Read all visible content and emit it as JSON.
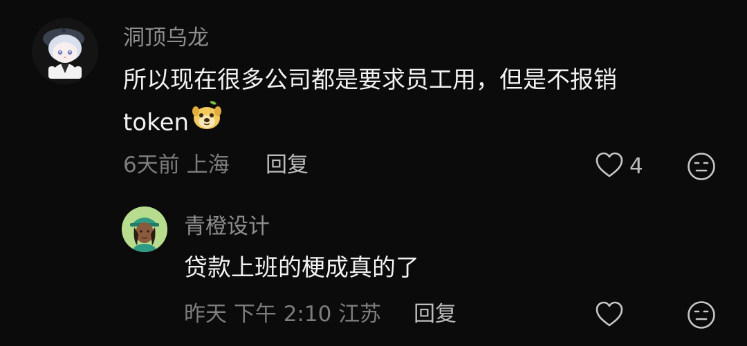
{
  "comments": [
    {
      "username": "洞顶乌龙",
      "text_line1": "所以现在很多公司都是要求员工用，但是不报销",
      "text_line2": "token",
      "inline_emoji": "doge-emoji-icon",
      "time": "6天前",
      "location": "上海",
      "reply_label": "回复",
      "likes": "4"
    },
    {
      "username": "青橙设计",
      "text": "贷款上班的梗成真的了",
      "time": "昨天 下午 2:10",
      "location": "江苏",
      "reply_label": "回复",
      "likes": ""
    }
  ],
  "colors": {
    "background": "#0b0b0b",
    "username": "#8e8e8e",
    "body_text": "#f2f2f2",
    "meta_text": "#7d7d7d",
    "icon": "#bdbdbd"
  }
}
